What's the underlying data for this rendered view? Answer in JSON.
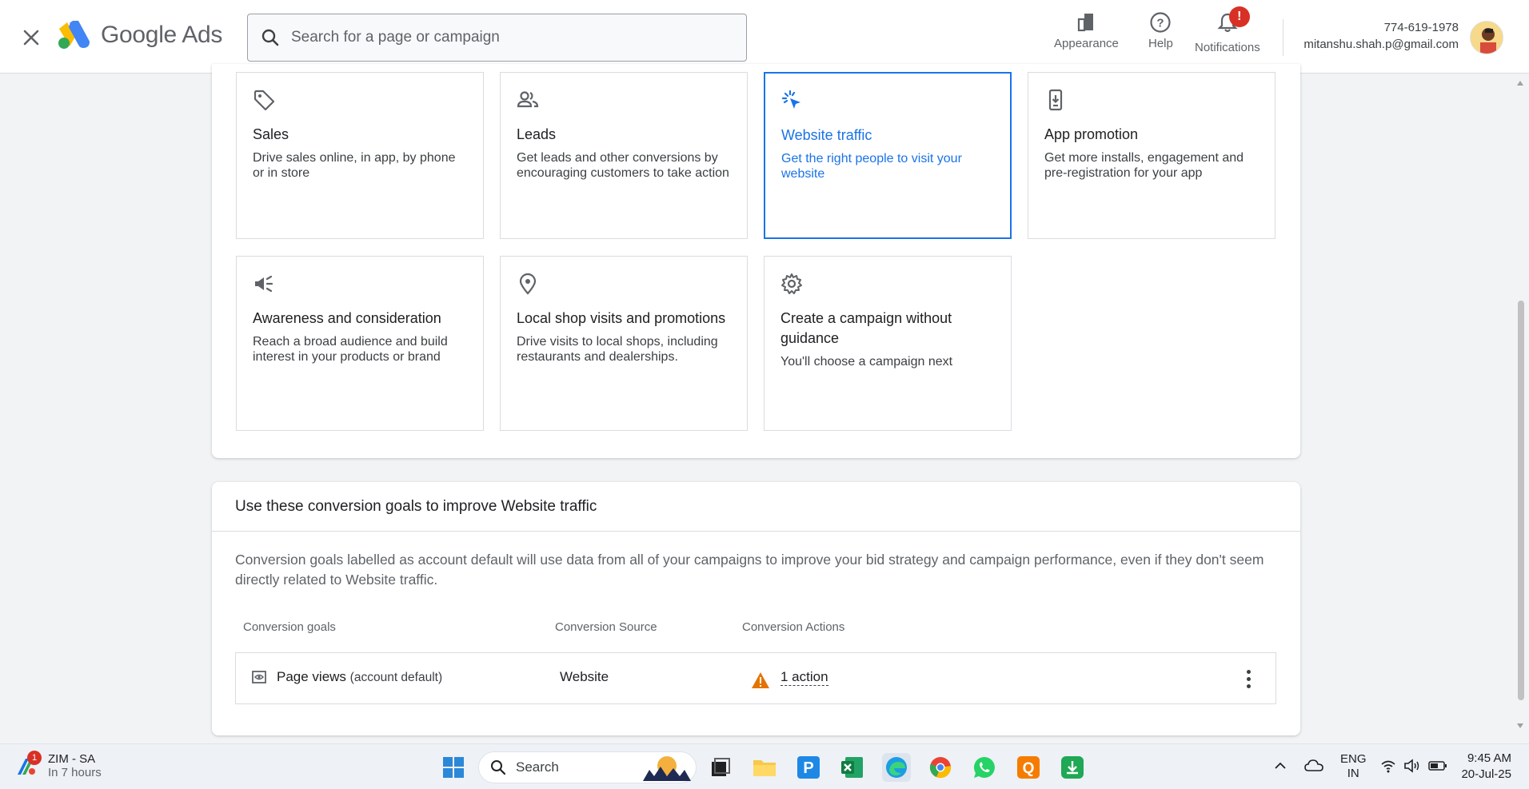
{
  "header": {
    "close_label": "Close",
    "logo_text": "Google Ads",
    "search_placeholder": "Search for a page or campaign",
    "actions": [
      {
        "label": "Appearance",
        "icon": "appearance-icon"
      },
      {
        "label": "Help",
        "icon": "help-icon"
      },
      {
        "label": "Notifications",
        "icon": "bell-icon",
        "badge": "!"
      }
    ],
    "account_phone": "774-619-1978",
    "account_email": "mitanshu.shah.p@gmail.com"
  },
  "objectives": [
    {
      "title": "Sales",
      "desc": "Drive sales online, in app, by phone or in store",
      "icon": "tag-icon",
      "selected": false
    },
    {
      "title": "Leads",
      "desc": "Get leads and other conversions by encouraging customers to take action",
      "icon": "people-icon",
      "selected": false
    },
    {
      "title": "Website traffic",
      "desc": "Get the right people to visit your website",
      "icon": "cursor-click-icon",
      "selected": true
    },
    {
      "title": "App promotion",
      "desc": "Get more installs, engagement and pre-registration for your app",
      "icon": "phone-download-icon",
      "selected": false
    },
    {
      "title": "Awareness and consideration",
      "desc": "Reach a broad audience and build interest in your products or brand",
      "icon": "megaphone-icon",
      "selected": false
    },
    {
      "title": "Local shop visits and promotions",
      "desc": "Drive visits to local shops, including restaurants and dealerships.",
      "icon": "location-pin-icon",
      "selected": false
    },
    {
      "title": "Create a campaign without guidance",
      "desc": "You'll choose a campaign next",
      "icon": "gear-icon",
      "selected": false
    }
  ],
  "conversion": {
    "heading": "Use these conversion goals to improve Website traffic",
    "description": "Conversion goals labelled as account default will use data from all of your campaigns to improve your bid strategy and campaign performance, even if they don't seem directly related to Website traffic.",
    "columns": [
      "Conversion goals",
      "Conversion Source",
      "Conversion Actions"
    ],
    "rows": [
      {
        "goal": "Page views",
        "goal_note": "(account default)",
        "source": "Website",
        "actions": "1 action"
      }
    ]
  },
  "taskbar": {
    "weather_title": "ZIM - SA",
    "weather_sub": "In 7 hours",
    "weather_badge": "1",
    "search_label": "Search",
    "lang_top": "ENG",
    "lang_bottom": "IN",
    "time": "9:45 AM",
    "date": "20-Jul-25"
  }
}
